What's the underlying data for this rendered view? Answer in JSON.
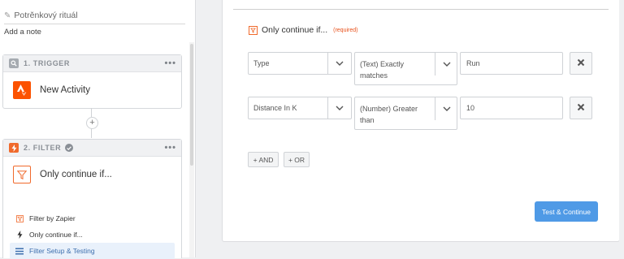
{
  "sidebar": {
    "zap_name": "Potrěnkový rituál",
    "add_note": "Add a note",
    "trigger": {
      "header": "1. TRIGGER",
      "app_label": "New Activity"
    },
    "filter": {
      "header": "2. FILTER",
      "app_label": "Only continue if...",
      "sub_items": [
        {
          "label": "Filter by Zapier"
        },
        {
          "label": "Only continue if..."
        },
        {
          "label": "Filter Setup & Testing"
        }
      ]
    },
    "dots": "•••",
    "plus": "+"
  },
  "main": {
    "title": "Only continue if...",
    "required": "(required)",
    "rules": [
      {
        "field": "Type",
        "condition": "(Text) Exactly matches",
        "value": "Run"
      },
      {
        "field": "Distance In K",
        "condition": "(Number) Greater than",
        "value": "10"
      }
    ],
    "and_label": "+ AND",
    "or_label": "+ OR",
    "submit_label": "Test & Continue"
  },
  "colors": {
    "accent_orange": "#f06a2c",
    "strava_orange": "#fc5200",
    "primary_blue": "#4f9ae6",
    "active_bg": "#e9f1fb"
  }
}
